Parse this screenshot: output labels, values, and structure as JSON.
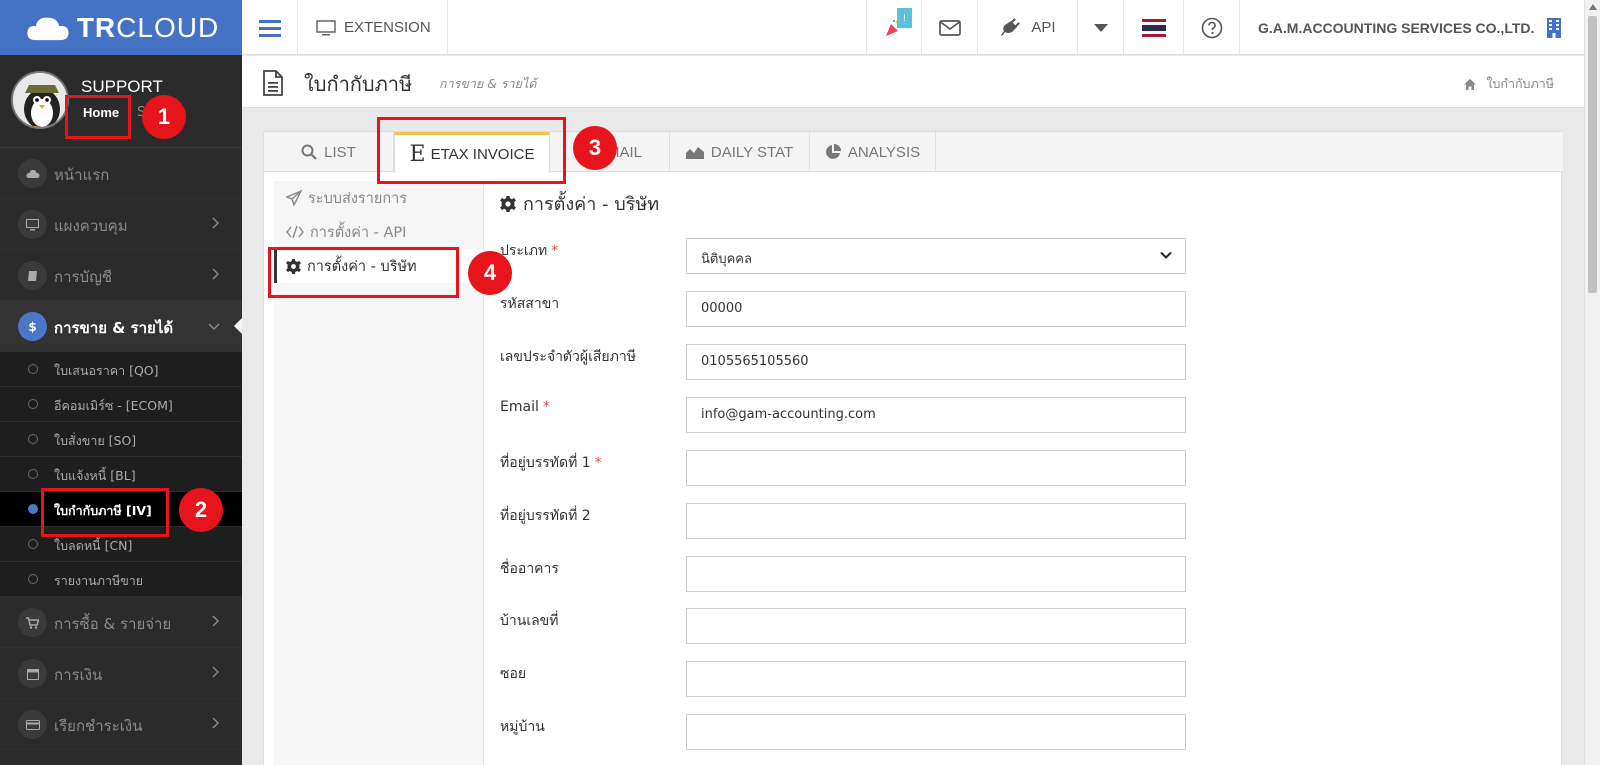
{
  "brand": {
    "logo_text_bold": "TR",
    "logo_text": "CLOUD"
  },
  "profile": {
    "name": "SUPPORT",
    "home": "Home",
    "extra": "S"
  },
  "sidebar": {
    "items": [
      {
        "label": "หน้าแรก"
      },
      {
        "label": "แผงควบคุม"
      },
      {
        "label": "การบัญชี"
      },
      {
        "label": "การขาย & รายได้"
      },
      {
        "label": "การซื้อ & รายจ่าย"
      },
      {
        "label": "การเงิน"
      },
      {
        "label": "เรียกชำระเงิน"
      }
    ],
    "sales_icon": "$",
    "sub_items": [
      {
        "label": "ใบเสนอราคา [QO]"
      },
      {
        "label": "อีคอมเมิร์ซ - [ECOM]"
      },
      {
        "label": "ใบสั่งขาย [SO]"
      },
      {
        "label": "ใบแจ้งหนี้ [BL]"
      },
      {
        "label": "ใบกำกับภาษี [IV]"
      },
      {
        "label": "ใบลดหนี้ [CN]"
      },
      {
        "label": "รายงานภาษีขาย"
      }
    ]
  },
  "topbar": {
    "extension": "EXTENSION",
    "badge": "!",
    "api": "API",
    "company": "G.A.M.ACCOUNTING SERVICES CO.,LTD."
  },
  "page": {
    "title": "ใบกำกับภาษี",
    "subtitle": "การขาย & รายได้",
    "breadcrumb": "ใบกำกับภาษี"
  },
  "tabs": {
    "list": "LIST",
    "etax_letter": "E",
    "etax": "ETAX INVOICE",
    "email": "MAIL",
    "daily": "DAILY STAT",
    "analysis": "ANALYSIS"
  },
  "subnav": {
    "send": "ระบบส่งรายการ",
    "api": "การตั้งค่า - API",
    "company": "การตั้งค่า - บริษัท"
  },
  "form": {
    "title": "การตั้งค่า - บริษัท",
    "required_mark": "*",
    "type_label": "ประเภท",
    "type_value": "นิติบุคคล",
    "branch_label": "รหัสสาขา",
    "branch_value": "00000",
    "taxid_label": "เลขประจำตัวผู้เสียภาษี",
    "taxid_value": "0105565105560",
    "email_label": "Email",
    "email_value": "info@gam-accounting.com",
    "addr1_label": "ที่อยู่บรรทัดที่ 1",
    "addr2_label": "ที่อยู่บรรทัดที่ 2",
    "building_label": "ชื่ออาคาร",
    "house_label": "บ้านเลขที่",
    "soi_label": "ซอย",
    "village_label": "หมู่บ้าน"
  },
  "annotations": [
    "1",
    "2",
    "3",
    "4"
  ],
  "colors": {
    "accent": "#4472c4",
    "annotation": "#e8141c",
    "tab_active": "#f0c04a"
  }
}
